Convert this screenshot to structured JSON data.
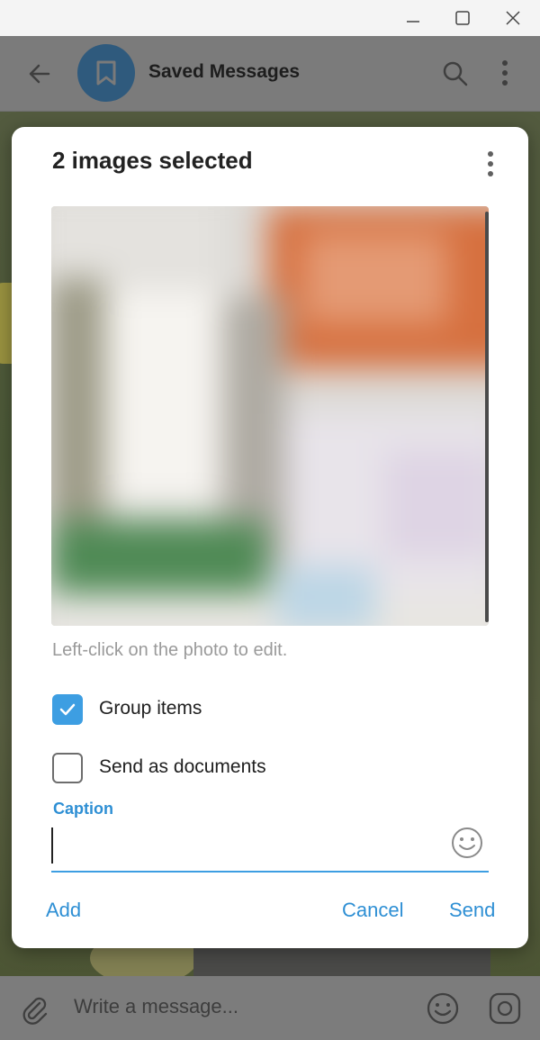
{
  "chat": {
    "title": "Saved Messages",
    "composer_placeholder": "Write a message..."
  },
  "modal": {
    "title": "2 images selected",
    "hint": "Left-click on the photo to edit.",
    "group_items": {
      "label": "Group items",
      "checked": true
    },
    "send_as_documents": {
      "label": "Send as documents",
      "checked": false
    },
    "caption": {
      "label": "Caption",
      "value": "",
      "placeholder": ""
    },
    "actions": {
      "add": "Add",
      "cancel": "Cancel",
      "send": "Send"
    }
  },
  "icons": {
    "window": [
      "minimize-icon",
      "maximize-icon",
      "close-icon"
    ],
    "header": [
      "back-arrow-icon",
      "bookmark-icon",
      "search-icon",
      "more-vert-icon"
    ],
    "composer": [
      "paperclip-icon",
      "emoji-icon",
      "sticker-icon"
    ]
  },
  "colors": {
    "accent": "#3d9ee2",
    "link": "#2e8fd4",
    "avatar": "#2f5a7d"
  }
}
